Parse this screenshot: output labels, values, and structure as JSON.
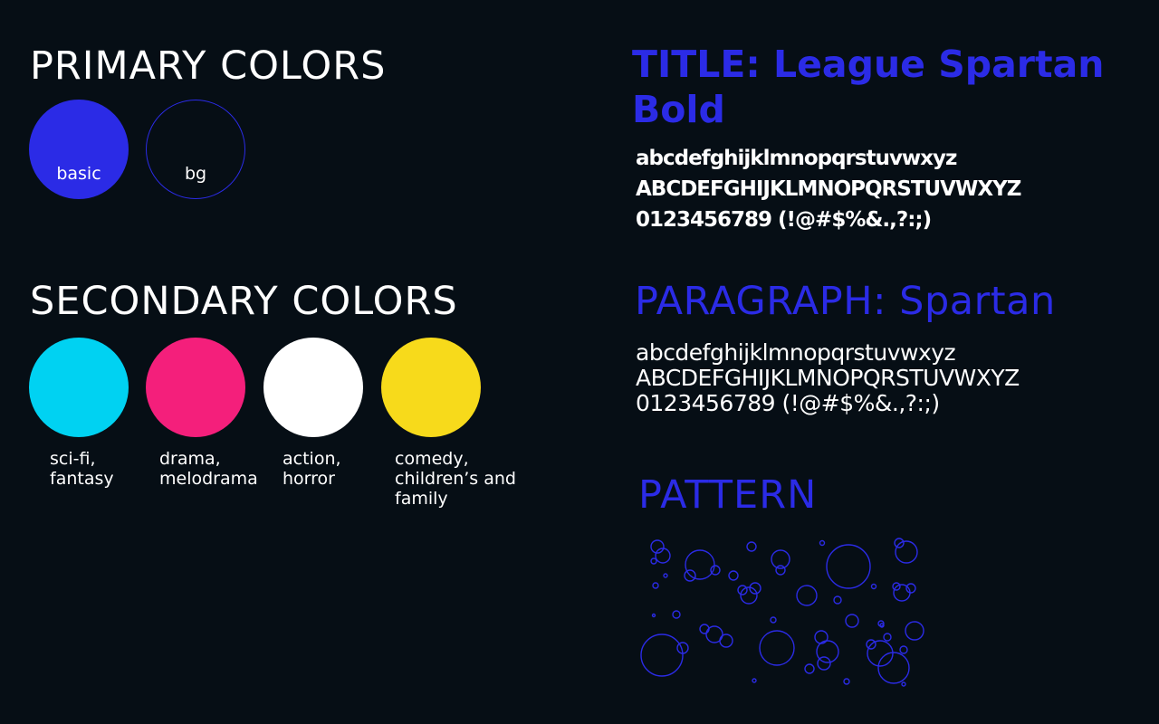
{
  "primary": {
    "heading": "PRIMARY COLORS",
    "swatches": [
      {
        "label": "basic",
        "color": "#2b2be6"
      },
      {
        "label": "bg",
        "color": "#060e15",
        "outline": "#2b2be6"
      }
    ]
  },
  "secondary": {
    "heading": "SECONDARY COLORS",
    "swatches": [
      {
        "line1": "sci-fi,",
        "line2": "fantasy",
        "line3": "",
        "color": "#00d2f2"
      },
      {
        "line1": "drama,",
        "line2": "melodrama",
        "line3": "",
        "color": "#f41f7b"
      },
      {
        "line1": "action,",
        "line2": "horror",
        "line3": "",
        "color": "#ffffff"
      },
      {
        "line1": "comedy,",
        "line2": "children’s and",
        "line3": "family",
        "color": "#f7da1b"
      }
    ]
  },
  "typography": {
    "title_font": {
      "label_line1": "TITLE: League Spartan",
      "label_line2": "Bold",
      "lowercase": "abcdefghijklmnopqrstuvwxyz",
      "uppercase": "ABCDEFGHIJKLMNOPQRSTUVWXYZ",
      "numbers": "0123456789 (!@#$%&.,?:;)"
    },
    "paragraph_font": {
      "label": "PARAGRAPH: Spartan",
      "lowercase": "abcdefghijklmnopqrstuvwxyz",
      "uppercase": "ABCDEFGHIJKLMNOPQRSTUVWXYZ",
      "numbers": "0123456789 (!@#$%&.,?:;)"
    },
    "accent_color": "#2b2be6"
  },
  "pattern": {
    "heading": "PATTERN",
    "stroke_color": "#2b2be6"
  }
}
